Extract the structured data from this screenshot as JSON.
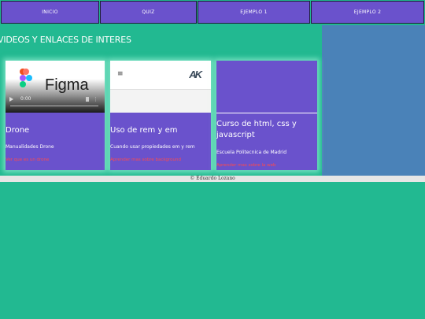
{
  "nav": {
    "items": [
      {
        "label": "INICIO"
      },
      {
        "label": "QUIZ"
      },
      {
        "label": "EJEMPLO 1"
      },
      {
        "label": "EJEMPLO 2"
      }
    ]
  },
  "section": {
    "title": "VIDEOS Y ENLACES DE INTERES"
  },
  "cards": [
    {
      "media": {
        "brand": "Figma",
        "time": "0:00"
      },
      "title": "Drone",
      "description": "Manualidades Drone",
      "link": "Ver que es un drone"
    },
    {
      "media": {
        "logo": "AK"
      },
      "title": "Uso de rem y em",
      "description": "Cuando usar propiedades em y rem",
      "link": "Aprender mas sobre background"
    },
    {
      "media": {},
      "title": "Curso de html, css y javascript",
      "description": "Escuela Politecnica de Madrid",
      "link": "Aprender mas sobre la web"
    }
  ],
  "footer": {
    "text": "© Eduardo Lozano"
  },
  "colors": {
    "background": "#22b991",
    "nav": "#6a52cc",
    "aside": "#4a82b8",
    "card": "#6a52cc",
    "link": "#ff4a4a"
  }
}
